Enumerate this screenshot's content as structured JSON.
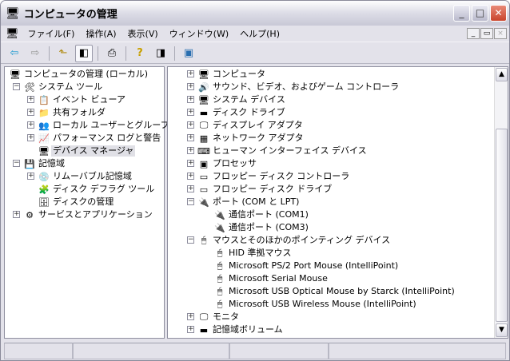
{
  "window": {
    "title": "コンピュータの管理",
    "icon": "computer-management-icon"
  },
  "menu": [
    "ファイル(F)",
    "操作(A)",
    "表示(V)",
    "ウィンドウ(W)",
    "ヘルプ(H)"
  ],
  "mdi_buttons": {
    "minimize": "_",
    "restore": "▭",
    "close": "×"
  },
  "caption_buttons": {
    "minimize": "_",
    "maximize": "□",
    "close": "✕"
  },
  "toolbar": [
    "back-icon",
    "forward-icon",
    "up-folder-icon",
    "show-hide-tree-icon",
    "print-icon",
    "help-icon",
    "show-hide-action-pane-icon",
    "properties-icon"
  ],
  "left_tree": [
    {
      "level": 0,
      "exp": "",
      "label": "コンピュータの管理 (ローカル)",
      "icon": "🖥"
    },
    {
      "level": 1,
      "exp": "-",
      "label": "システム ツール",
      "icon": "🛠"
    },
    {
      "level": 2,
      "exp": "+",
      "label": "イベント ビューア",
      "icon": "📋"
    },
    {
      "level": 2,
      "exp": "+",
      "label": "共有フォルダ",
      "icon": "📁"
    },
    {
      "level": 2,
      "exp": "+",
      "label": "ローカル ユーザーとグループ",
      "icon": "👥"
    },
    {
      "level": 2,
      "exp": "+",
      "label": "パフォーマンス ログと警告",
      "icon": "📈"
    },
    {
      "level": 2,
      "exp": "",
      "label": "デバイス マネージャ",
      "icon": "🖥",
      "selected": true
    },
    {
      "level": 1,
      "exp": "-",
      "label": "記憶域",
      "icon": "💾"
    },
    {
      "level": 2,
      "exp": "+",
      "label": "リムーバブル記憶域",
      "icon": "💿"
    },
    {
      "level": 2,
      "exp": "",
      "label": "ディスク デフラグ ツール",
      "icon": "🧩"
    },
    {
      "level": 2,
      "exp": "",
      "label": "ディスクの管理",
      "icon": "🗄"
    },
    {
      "level": 1,
      "exp": "+",
      "label": "サービスとアプリケーション",
      "icon": "⚙"
    }
  ],
  "right_tree": [
    {
      "level": 0,
      "exp": "+",
      "label": "コンピュータ",
      "icon": "🖥"
    },
    {
      "level": 0,
      "exp": "+",
      "label": "サウンド、ビデオ、およびゲーム コントローラ",
      "icon": "🔊"
    },
    {
      "level": 0,
      "exp": "+",
      "label": "システム デバイス",
      "icon": "🖥"
    },
    {
      "level": 0,
      "exp": "+",
      "label": "ディスク ドライブ",
      "icon": "▬"
    },
    {
      "level": 0,
      "exp": "+",
      "label": "ディスプレイ アダプタ",
      "icon": "🖵"
    },
    {
      "level": 0,
      "exp": "+",
      "label": "ネットワーク アダプタ",
      "icon": "▦"
    },
    {
      "level": 0,
      "exp": "+",
      "label": "ヒューマン インターフェイス デバイス",
      "icon": "⌨"
    },
    {
      "level": 0,
      "exp": "+",
      "label": "プロセッサ",
      "icon": "▣"
    },
    {
      "level": 0,
      "exp": "+",
      "label": "フロッピー ディスク コントローラ",
      "icon": "▭"
    },
    {
      "level": 0,
      "exp": "+",
      "label": "フロッピー ディスク ドライブ",
      "icon": "▭"
    },
    {
      "level": 0,
      "exp": "-",
      "label": "ポート (COM と LPT)",
      "icon": "🔌"
    },
    {
      "level": 1,
      "exp": "",
      "label": "通信ポート (COM1)",
      "icon": "🔌"
    },
    {
      "level": 1,
      "exp": "",
      "label": "通信ポート (COM3)",
      "icon": "🔌"
    },
    {
      "level": 0,
      "exp": "-",
      "label": "マウスとそのほかのポインティング デバイス",
      "icon": "🖱"
    },
    {
      "level": 1,
      "exp": "",
      "label": "HID 準拠マウス",
      "icon": "🖱"
    },
    {
      "level": 1,
      "exp": "",
      "label": "Microsoft PS/2 Port Mouse (IntelliPoint)",
      "icon": "🖱"
    },
    {
      "level": 1,
      "exp": "",
      "label": "Microsoft Serial Mouse",
      "icon": "🖱"
    },
    {
      "level": 1,
      "exp": "",
      "label": "Microsoft USB Optical Mouse by Starck (IntelliPoint)",
      "icon": "🖱"
    },
    {
      "level": 1,
      "exp": "",
      "label": "Microsoft USB Wireless Mouse (IntelliPoint)",
      "icon": "🖱"
    },
    {
      "level": 0,
      "exp": "+",
      "label": "モニタ",
      "icon": "🖵"
    },
    {
      "level": 0,
      "exp": "+",
      "label": "記憶域ボリューム",
      "icon": "▬"
    }
  ],
  "scrollbar": {
    "up": "▲",
    "down": "▼",
    "position": 0.85
  }
}
